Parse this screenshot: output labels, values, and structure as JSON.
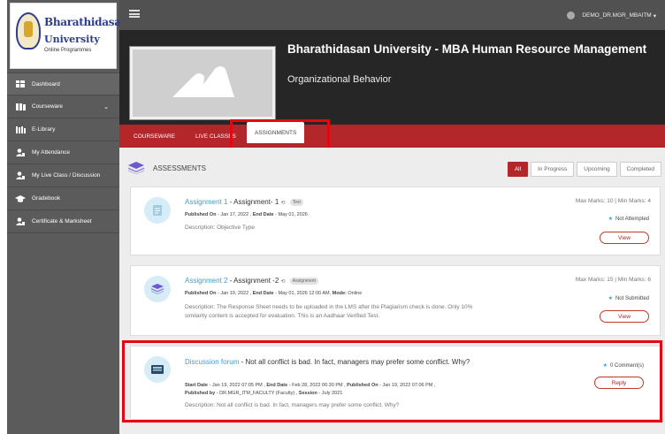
{
  "logo": {
    "line1": "Bharathidasan",
    "line2": "University",
    "line3": "Online Programmes"
  },
  "sidebar": {
    "items": [
      {
        "label": "Dashboard",
        "icon": "dashboard-icon"
      },
      {
        "label": "Courseware",
        "icon": "books-icon"
      },
      {
        "label": "E-Library",
        "icon": "library-icon"
      },
      {
        "label": "My Attendance",
        "icon": "user-icon"
      },
      {
        "label": "My Live Class / Discussion",
        "icon": "user-icon"
      },
      {
        "label": "Gradebook",
        "icon": "graduation-cap-icon"
      },
      {
        "label": "Certificate & Marksheet",
        "icon": "user-icon"
      }
    ]
  },
  "topbar": {
    "user": "DEMO_DR.MGR_MBAITM"
  },
  "course": {
    "title": "Bharathidasan University - MBA Human Resource Management",
    "subtitle": "Organizational Behavior"
  },
  "tabs": [
    "COURSEWARE",
    "LIVE CLASSES",
    "ASSIGNMENTS"
  ],
  "assessments": {
    "heading": "ASSESSMENTS",
    "filters": [
      "All",
      "In Progress",
      "Upcoming",
      "Completed"
    ]
  },
  "cards": [
    {
      "link": "Assignment 1",
      "title_rest": " - Assignment- 1",
      "tag": "Test",
      "published_label": "Published On",
      "published": "- Jan 17, 2022 ,",
      "end_label": "End Date",
      "end": "- May 01, 2026",
      "description": "Description: Objective Type",
      "marks": "Max Marks: 10 | Min Marks: 4",
      "status": "Not Attempted",
      "button": "View"
    },
    {
      "link": "Assignment 2",
      "title_rest": " - Assignment -2",
      "tag": "Assignment",
      "published_label": "Published On",
      "published": "- Jan 19, 2022 ,",
      "end_label": "End Date",
      "end": "- May 01, 2026 12:00 AM,",
      "mode_label": "Mode:",
      "mode": "Online",
      "description": "Description: The Response Sheet needs to be uploaded in the LMS after the Plagiarism check is done. Only 10% similarity content is accepted for evaluation. This is an Aadhaar Verified Test.",
      "marks": "Max Marks: 15 | Min Marks: 6",
      "status": "Not Submitted",
      "button": "View"
    },
    {
      "link": "Discussion forum",
      "title_rest": " - Not all conflict is bad. In fact, managers may prefer some conflict. Why?",
      "start_label": "Start Date",
      "start": "- Jan 19, 2022 07:05 PM ,",
      "end_label": "End Date",
      "end": "- Feb 28, 2022 06:30 PM ,",
      "published_label": "Published On",
      "published": "- Jan 19, 2022 07:06 PM ,",
      "by_label": "Published by",
      "by": "- DR.MGR_ITM_FACULTY (Faculty) ,",
      "session_label": "Session",
      "session": "- July 2021",
      "description": "Description: Not all conflict is bad. In fact, managers may prefer some conflict. Why?",
      "status": "0 Comment(s)",
      "button": "Reply"
    }
  ],
  "colors": {
    "accent": "#b3262a",
    "link": "#3a9fd7",
    "highlight": "#e30613"
  }
}
